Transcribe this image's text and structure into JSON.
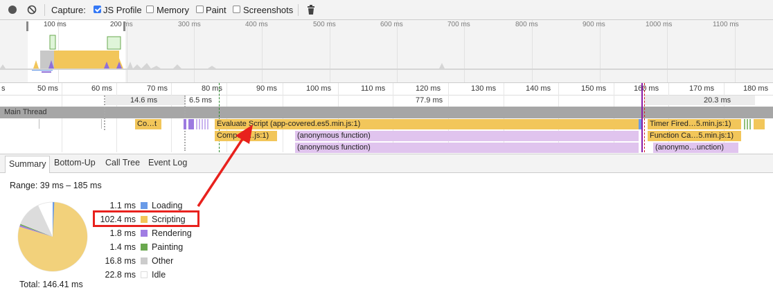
{
  "toolbar": {
    "record_icon": "record-icon",
    "clear_icon": "clear-icon",
    "capture_label": "Capture:",
    "options": [
      {
        "label": "JS Profile",
        "checked": true
      },
      {
        "label": "Memory",
        "checked": false
      },
      {
        "label": "Paint",
        "checked": false
      },
      {
        "label": "Screenshots",
        "checked": false
      }
    ],
    "trash_icon": "trash-icon"
  },
  "overview": {
    "time_labels": [
      "100 ms",
      "200 ms",
      "300 ms",
      "400 ms",
      "500 ms",
      "600 ms",
      "700 ms",
      "800 ms",
      "900 ms",
      "1000 ms",
      "1100 ms"
    ]
  },
  "flame": {
    "ruler_labels": [
      "s",
      "50 ms",
      "60 ms",
      "70 ms",
      "80 ms",
      "90 ms",
      "100 ms",
      "110 ms",
      "120 ms",
      "130 ms",
      "140 ms",
      "150 ms",
      "160 ms",
      "170 ms",
      "180 ms"
    ],
    "gap_labels": [
      "14.6 ms",
      "6.5 ms",
      "77.9 ms",
      "20.3 ms"
    ],
    "main_thread_label": "Main Thread",
    "events": {
      "compile_short": "Co…t",
      "evaluate_script": "Evaluate Script (app-covered.es5.min.js:1)",
      "timer_fired": "Timer Fired…5.min.js:1)",
      "compile_script": "Comp…  …js:1)",
      "anon_1": "(anonymous function)",
      "function_call": "Function Ca…5.min.js:1)",
      "anon_2": "(anonymous function)",
      "anon_3": "(anonymo…unction)"
    }
  },
  "tabs": [
    "Summary",
    "Bottom-Up",
    "Call Tree",
    "Event Log"
  ],
  "summary": {
    "range": "Range: 39 ms – 185 ms",
    "total": "Total: 146.41 ms",
    "legend": [
      {
        "value": "1.1 ms",
        "name": "Loading",
        "color": "#6a9be8"
      },
      {
        "value": "102.4 ms",
        "name": "Scripting",
        "color": "#f2c65a"
      },
      {
        "value": "1.8 ms",
        "name": "Rendering",
        "color": "#a07de3"
      },
      {
        "value": "1.4 ms",
        "name": "Painting",
        "color": "#6aa84f"
      },
      {
        "value": "16.8 ms",
        "name": "Other",
        "color": "#cccccc"
      },
      {
        "value": "22.8 ms",
        "name": "Idle",
        "color": "#ffffff"
      }
    ]
  },
  "colors": {
    "annotation_red": "#e8211d",
    "scripting": "#f2c65a",
    "function": "#e0c4ee"
  }
}
